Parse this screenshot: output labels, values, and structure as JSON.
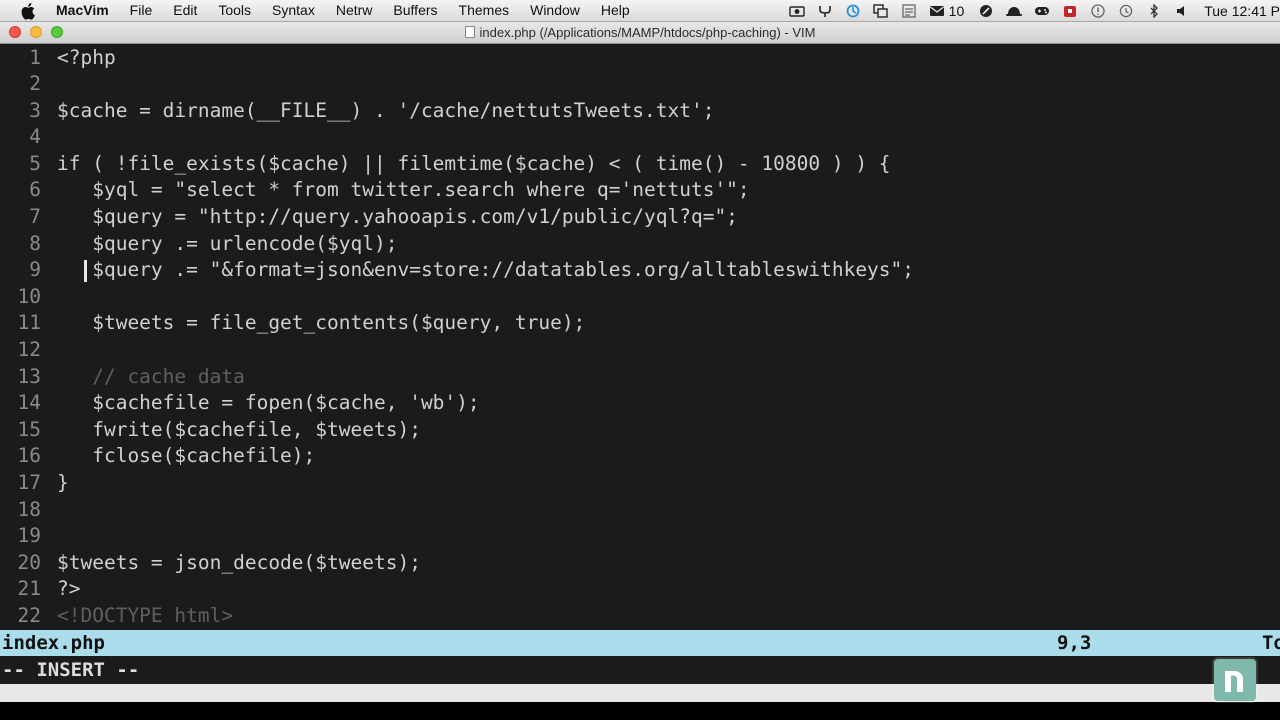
{
  "menubar": {
    "app_name": "MacVim",
    "menus": [
      "File",
      "Edit",
      "Tools",
      "Syntax",
      "Netrw",
      "Buffers",
      "Themes",
      "Window",
      "Help"
    ],
    "mail_count": "10",
    "clock": "Tue 12:41 P"
  },
  "window": {
    "title": "index.php (/Applications/MAMP/htdocs/php-caching) - VIM"
  },
  "editor": {
    "lines": [
      {
        "n": "1",
        "text": "<?php"
      },
      {
        "n": "2",
        "text": ""
      },
      {
        "n": "3",
        "text": "$cache = dirname(__FILE__) . '/cache/nettutsTweets.txt';"
      },
      {
        "n": "4",
        "text": ""
      },
      {
        "n": "5",
        "text": "if ( !file_exists($cache) || filemtime($cache) < ( time() - 10800 ) ) {"
      },
      {
        "n": "6",
        "text": "   $yql = \"select * from twitter.search where q='nettuts'\";"
      },
      {
        "n": "7",
        "text": "   $query = \"http://query.yahooapis.com/v1/public/yql?q=\";"
      },
      {
        "n": "8",
        "text": "   $query .= urlencode($yql);"
      },
      {
        "n": "9",
        "text": "   $query .= \"&format=json&env=store://datatables.org/alltableswithkeys\";"
      },
      {
        "n": "10",
        "text": ""
      },
      {
        "n": "11",
        "text": "   $tweets = file_get_contents($query, true);"
      },
      {
        "n": "12",
        "text": ""
      },
      {
        "n": "13",
        "text": "   // cache data"
      },
      {
        "n": "14",
        "text": "   $cachefile = fopen($cache, 'wb');"
      },
      {
        "n": "15",
        "text": "   fwrite($cachefile, $tweets);"
      },
      {
        "n": "16",
        "text": "   fclose($cachefile);"
      },
      {
        "n": "17",
        "text": "}"
      },
      {
        "n": "18",
        "text": ""
      },
      {
        "n": "19",
        "text": ""
      },
      {
        "n": "20",
        "text": "$tweets = json_decode($tweets);"
      },
      {
        "n": "21",
        "text": "?>"
      },
      {
        "n": "22",
        "text": "<!DOCTYPE html>"
      }
    ]
  },
  "statusline": {
    "filename": "index.php",
    "position": "9,3",
    "tail": "To"
  },
  "modeline": {
    "mode": "-- INSERT --"
  },
  "colors": {
    "editor_bg": "#1b1b1b",
    "statusline_bg": "#aadceb",
    "line_number": "#8a8a8a",
    "comment": "#5f5f5f"
  }
}
